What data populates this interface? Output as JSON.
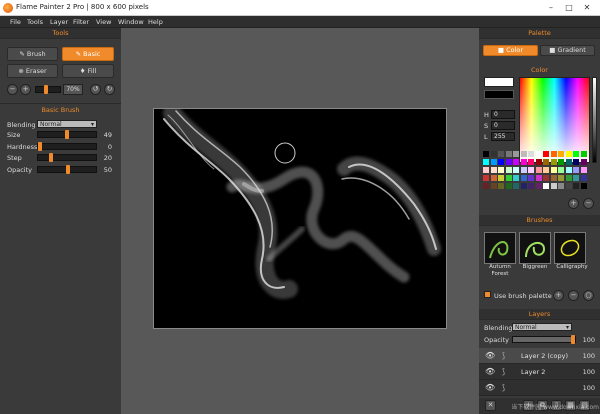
{
  "window": {
    "title": "Flame Painter 2 Pro | 800 x 600 pixels"
  },
  "menu": [
    "File",
    "Tools",
    "Layer",
    "Filter",
    "View",
    "Window",
    "Help"
  ],
  "tools": {
    "header": "Tools",
    "brush_label": "Brush",
    "basic_label": "Basic",
    "eraser_label": "Eraser",
    "fill_label": "Fill",
    "zoom": "70%"
  },
  "basic_brush": {
    "header": "Basic Brush",
    "blending_label": "Blending",
    "blending_value": "Normal",
    "params": [
      {
        "label": "Size",
        "value": "49",
        "fraction": 0.49
      },
      {
        "label": "Hardness",
        "value": "0",
        "fraction": 0.0
      },
      {
        "label": "Step",
        "value": "20",
        "fraction": 0.2
      },
      {
        "label": "Opacity",
        "value": "50",
        "fraction": 0.5
      }
    ]
  },
  "palette": {
    "header": "Palette",
    "color_tab": "Color",
    "gradient_tab": "Gradient",
    "color_header": "Color",
    "h_label": "H",
    "h_value": "0",
    "s_label": "S",
    "s_value": "0",
    "l_label": "L",
    "l_value": "255"
  },
  "brushes": {
    "header": "Brushes",
    "items": [
      "Autumn Forest",
      "Biggreen",
      "Calligraphy"
    ],
    "use_palette_label": "Use brush palette"
  },
  "layers": {
    "header": "Layers",
    "blending_label": "Blending",
    "blending_value": "Normal",
    "opacity_label": "Opacity",
    "opacity_value": "100",
    "opacity_fraction": 1.0,
    "items": [
      {
        "name": "Layer 2 (copy)",
        "opacity": "100"
      },
      {
        "name": "Layer 2",
        "opacity": "100"
      },
      {
        "name": "",
        "opacity": "100"
      }
    ]
  },
  "watermark": "当下软件园 www.downxia.com",
  "colors": {
    "accent": "#f08a2a"
  }
}
